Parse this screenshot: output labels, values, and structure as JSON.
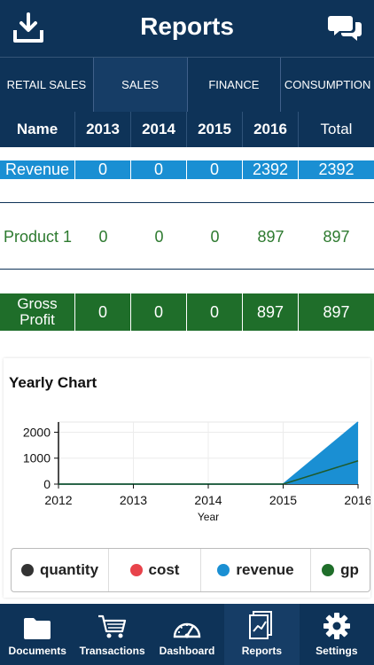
{
  "header": {
    "title": "Reports",
    "left_icon": "download-icon",
    "right_icon": "chat-icon"
  },
  "tabs": [
    {
      "label": "RETAIL SALES",
      "active": false
    },
    {
      "label": "SALES",
      "active": true
    },
    {
      "label": "FINANCE",
      "active": false
    },
    {
      "label": "CONSUMPTION",
      "active": false
    }
  ],
  "table": {
    "headers": [
      "Name",
      "2013",
      "2014",
      "2015",
      "2016",
      "Total"
    ],
    "rows": [
      {
        "name": "Revenue",
        "values": [
          "0",
          "0",
          "0",
          "2392",
          "2392"
        ]
      },
      {
        "name": "Product 1",
        "values": [
          "0",
          "0",
          "0",
          "897",
          "897"
        ]
      },
      {
        "name": "Gross Profit",
        "name_line1": "Gross",
        "name_line2": "Profit",
        "values": [
          "0",
          "0",
          "0",
          "897",
          "897"
        ]
      }
    ]
  },
  "chart": {
    "title": "Yearly Chart",
    "xlabel": "Year"
  },
  "chart_data": {
    "type": "area",
    "title": "Yearly Chart",
    "xlabel": "Year",
    "ylabel": "",
    "x": [
      2012,
      2013,
      2014,
      2015,
      2016
    ],
    "xlim": [
      2012,
      2016
    ],
    "ylim": [
      0,
      2392
    ],
    "yticks": [
      0,
      1000,
      2000
    ],
    "xticks": [
      2012,
      2013,
      2014,
      2015,
      2016
    ],
    "series": [
      {
        "name": "revenue",
        "values": [
          0,
          0,
          0,
          0,
          2392
        ],
        "color": "#1a8fd3"
      },
      {
        "name": "gp",
        "values": [
          0,
          0,
          0,
          0,
          897
        ],
        "color": "#1f6e2a"
      }
    ],
    "grid": true
  },
  "legend": [
    {
      "label": "quantity",
      "color": "#333333"
    },
    {
      "label": "cost",
      "color": "#e8434b"
    },
    {
      "label": "revenue",
      "color": "#1a8fd3"
    },
    {
      "label": "gp",
      "color": "#1f6e2a"
    }
  ],
  "nav": [
    {
      "label": "Documents",
      "icon": "folder-icon",
      "active": false
    },
    {
      "label": "Transactions",
      "icon": "cart-icon",
      "active": false
    },
    {
      "label": "Dashboard",
      "icon": "gauge-icon",
      "active": false
    },
    {
      "label": "Reports",
      "icon": "report-icon",
      "active": true
    },
    {
      "label": "Settings",
      "icon": "gear-icon",
      "active": false
    }
  ]
}
